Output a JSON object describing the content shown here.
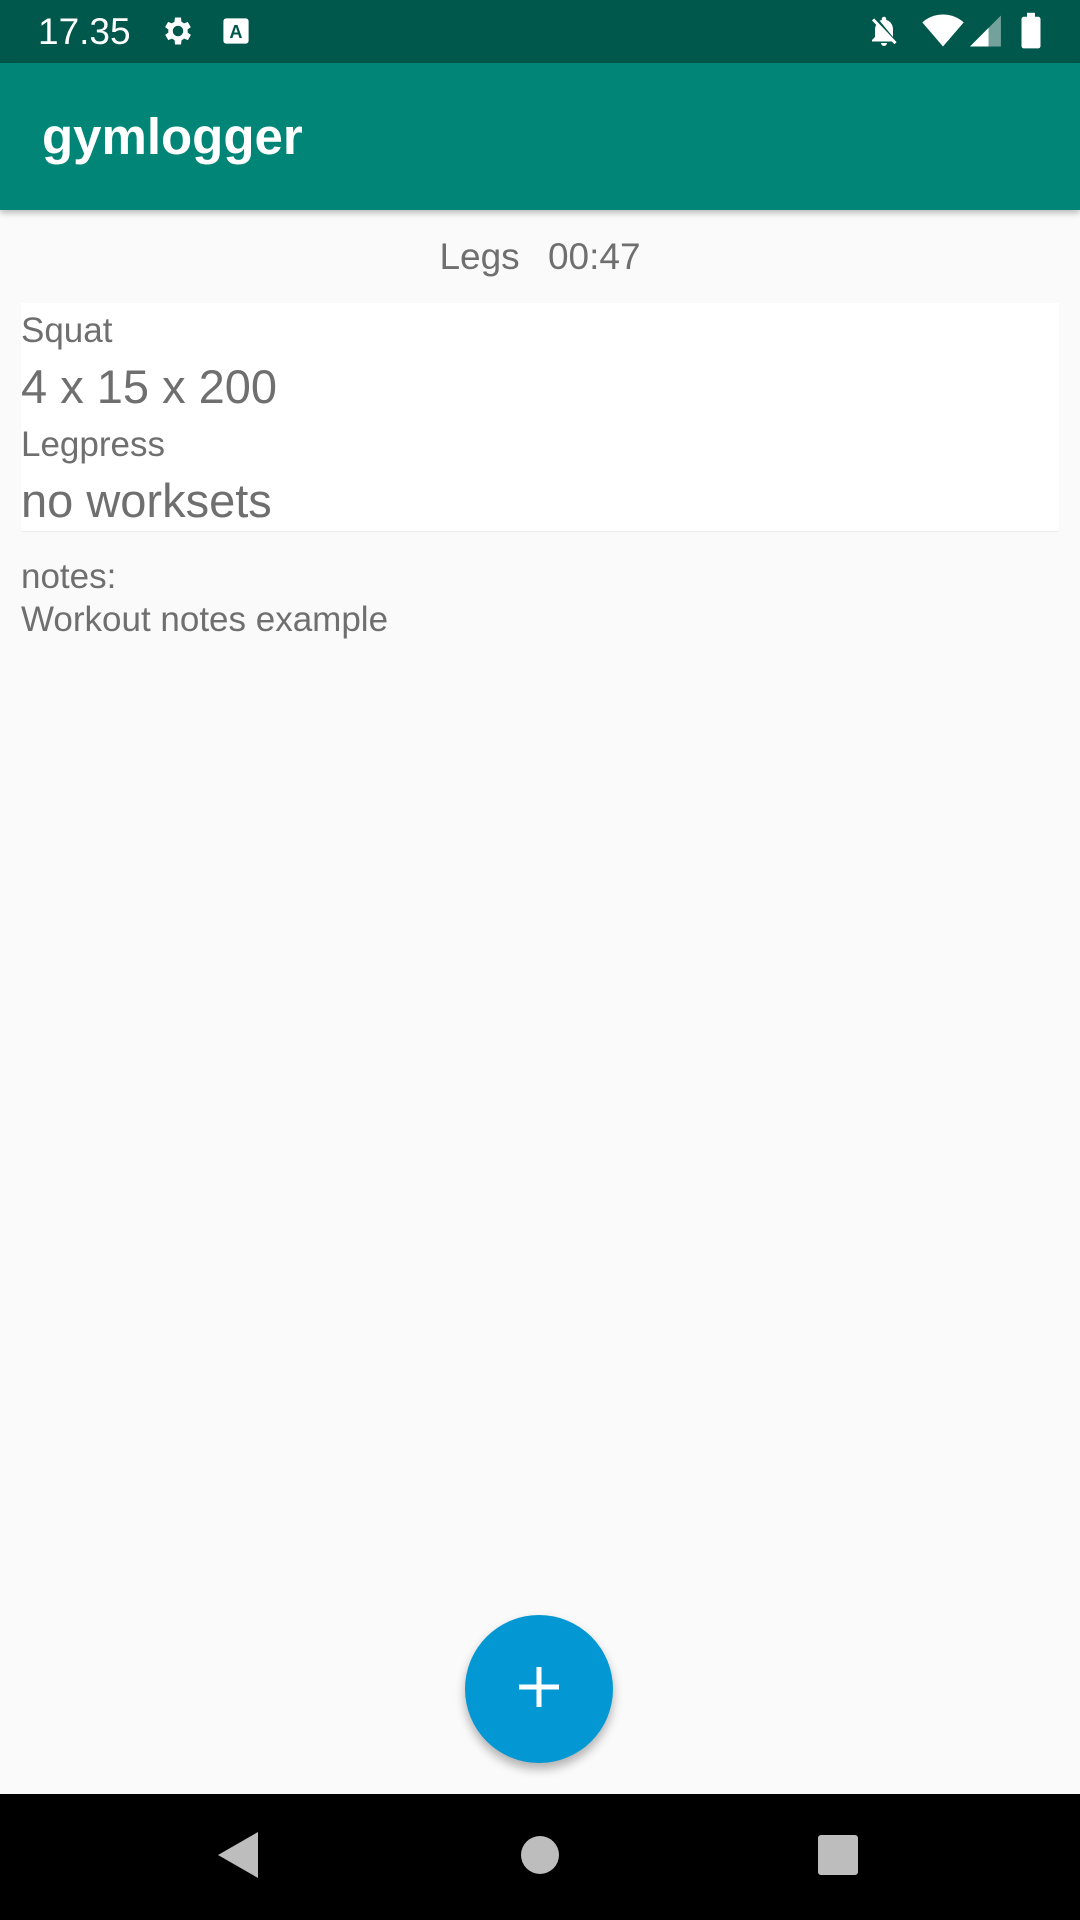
{
  "status_bar": {
    "time": "17.35",
    "icons": [
      "settings-icon",
      "keyboard-a-icon",
      "notifications-off-icon",
      "wifi-icon",
      "signal-icon",
      "battery-icon"
    ]
  },
  "app_bar": {
    "title": "gymlogger"
  },
  "workout": {
    "name": "Legs",
    "duration": "00:47"
  },
  "exercises": [
    {
      "name": "Squat",
      "sets": "4 x 15 x 200"
    },
    {
      "name": "Legpress",
      "sets": "no worksets"
    }
  ],
  "notes": {
    "label": "notes:",
    "text": "Workout notes example"
  },
  "fab": {
    "icon": "plus-icon",
    "color": "#0398d4"
  },
  "nav_bar": {
    "icons": [
      "back-icon",
      "home-icon",
      "recents-icon"
    ]
  },
  "colors": {
    "status_bar": "#00574b",
    "app_bar": "#008577",
    "background": "#fafafa",
    "text_secondary": "#6f6f6f"
  }
}
